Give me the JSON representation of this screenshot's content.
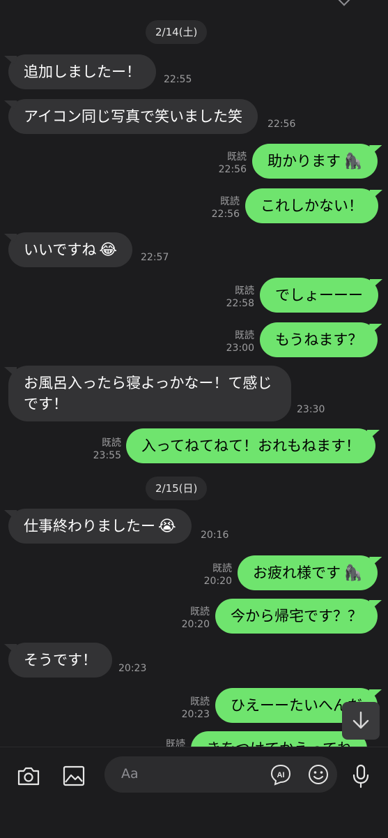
{
  "date_pills": [
    "2/14(土)",
    "2/15(日)"
  ],
  "messages": [
    {
      "side": "in",
      "text": "追加しましたー！",
      "time": "22:55"
    },
    {
      "side": "in",
      "text": "アイコン同じ写真で笑いました笑",
      "time": "22:56"
    },
    {
      "side": "out",
      "text": "助かります",
      "emoji": "🦍",
      "read": "既読",
      "time": "22:56"
    },
    {
      "side": "out",
      "text": "これしかない！",
      "read": "既読",
      "time": "22:56"
    },
    {
      "side": "in",
      "text": "いいですね",
      "emoji": "😂",
      "time": "22:57"
    },
    {
      "side": "out",
      "text": "でしょーーー",
      "read": "既読",
      "time": "22:58"
    },
    {
      "side": "out",
      "text": "もうねます？",
      "read": "既読",
      "time": "23:00"
    },
    {
      "side": "in",
      "line1": "お風呂入ったら寝よっかなー！て感じ",
      "line2": "です！",
      "time": "23:30"
    },
    {
      "side": "out",
      "text": "入ってねてねて！おれもねます！",
      "read": "既読",
      "time": "23:55"
    },
    {
      "side": "in",
      "text": "仕事終わりましたー",
      "emoji": "😭",
      "time": "20:16"
    },
    {
      "side": "out",
      "text": "お疲れ様です",
      "emoji": "🦍",
      "read": "既読",
      "time": "20:20"
    },
    {
      "side": "out",
      "text": "今から帰宅です？？",
      "read": "既読",
      "time": "20:20"
    },
    {
      "side": "in",
      "text": "そうです！",
      "time": "20:23"
    },
    {
      "side": "out",
      "text": "ひえーーたいへんだ",
      "read": "既読",
      "time": "20:23"
    },
    {
      "side": "out",
      "text": "きをつけてかえってね",
      "read": "既読",
      "time": ""
    }
  ],
  "composer": {
    "placeholder": "Aa",
    "ai_label": "AI",
    "icons": [
      "camera-icon",
      "image-icon",
      "ai-icon",
      "emoji-icon",
      "microphone-icon"
    ]
  },
  "colors": {
    "outgoing_bubble": "#6fe46e",
    "incoming_bubble": "#333335",
    "background": "#1c1c1e"
  }
}
